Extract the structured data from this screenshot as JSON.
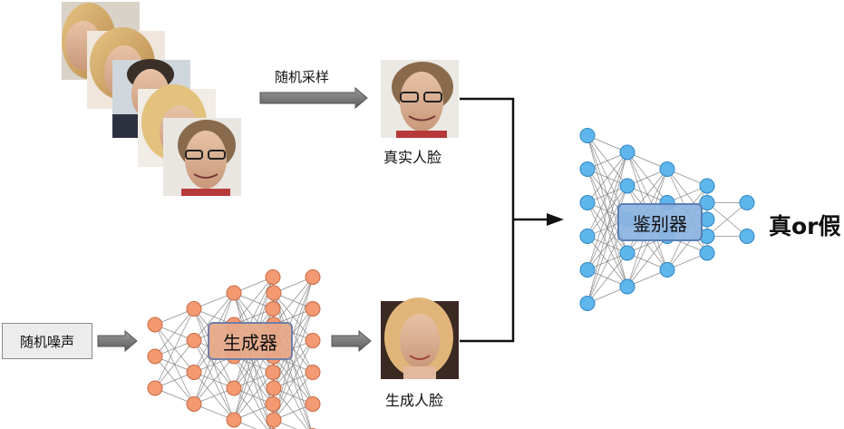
{
  "labels": {
    "random_sample": "随机采样",
    "real_face": "真实人脸",
    "random_noise": "随机噪声",
    "generator": "生成器",
    "generated_face": "生成人脸",
    "discriminator": "鉴别器",
    "result": "真or假"
  },
  "colors": {
    "generator_node": "#f39a72",
    "generator_node_stroke": "#c86a45",
    "discriminator_node": "#5fb6ec",
    "discriminator_node_stroke": "#2f86c4",
    "connection": "#8a8a8a",
    "arrow_fill": "#7a7a7a"
  },
  "networks": {
    "generator_layers": [
      3,
      4,
      5,
      6,
      5,
      6
    ],
    "discriminator_layers": [
      6,
      5,
      4,
      3,
      2,
      2
    ]
  },
  "images": {
    "photo_stack": [
      "face-photo-1",
      "face-photo-2",
      "face-photo-3",
      "face-photo-4",
      "face-photo-5"
    ],
    "real_face_photo": "real-face-photo",
    "generated_face_photo": "generated-face-photo"
  }
}
